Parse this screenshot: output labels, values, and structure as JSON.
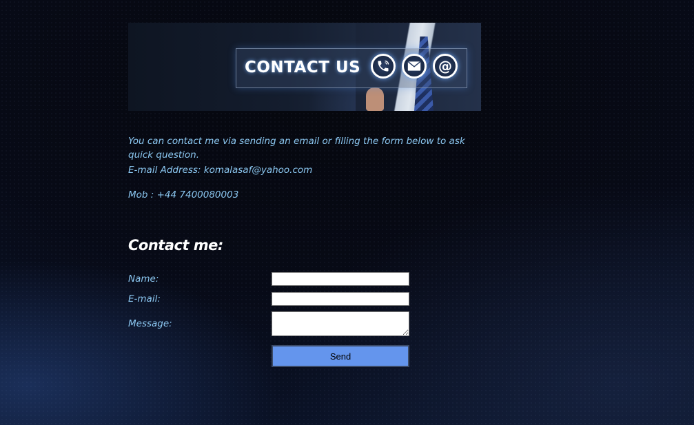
{
  "banner": {
    "title": "CONTACT US",
    "icons": [
      "phone-icon",
      "envelope-icon",
      "at-sign-icon"
    ]
  },
  "intro": {
    "text": "You can contact me via sending an email or filling the form below to ask quick question.",
    "email_line": "E-mail Address: komalasaf@yahoo.com",
    "mob_line": "Mob : +44 7400080003"
  },
  "form": {
    "heading": "Contact me:",
    "name_label": "Name:",
    "name_value": "",
    "email_label": "E-mail:",
    "email_value": "",
    "message_label": "Message:",
    "message_value": "",
    "send_label": "Send"
  },
  "colors": {
    "text_blue": "#8cc8f2",
    "button_blue": "#6495ed",
    "background_dark": "#070a16"
  }
}
